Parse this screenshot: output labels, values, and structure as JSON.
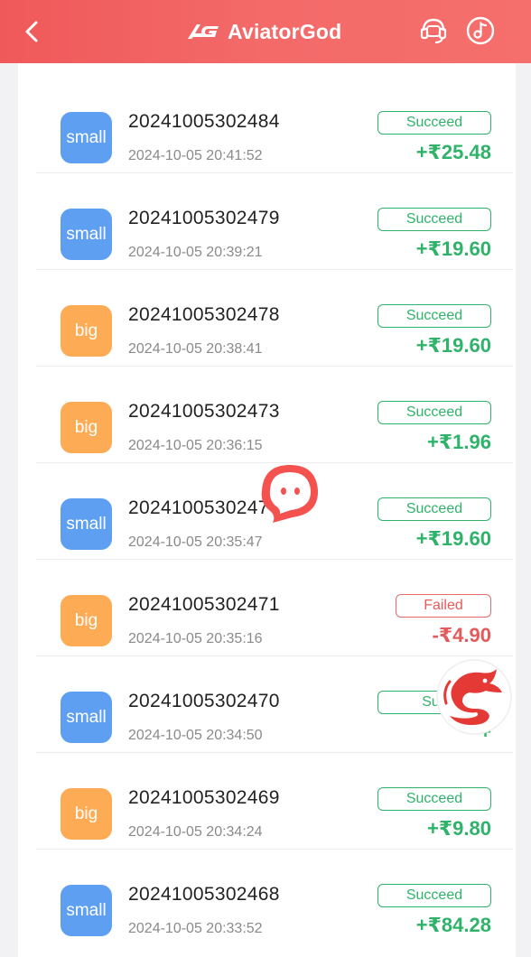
{
  "header": {
    "brand_name": "AviatorGod",
    "brand_mark": "AG",
    "icons": [
      "back-arrow-icon",
      "support-headset-icon",
      "music-note-icon"
    ],
    "colors": {
      "bar": "#f0595a",
      "text": "#ffffff"
    }
  },
  "records": [
    {
      "type": "small",
      "order": "20241005302484",
      "time": "2024-10-05 20:41:52",
      "status": "Succeed",
      "amount": "+₹25.48"
    },
    {
      "type": "small",
      "order": "20241005302479",
      "time": "2024-10-05 20:39:21",
      "status": "Succeed",
      "amount": "+₹19.60"
    },
    {
      "type": "big",
      "order": "20241005302478",
      "time": "2024-10-05 20:38:41",
      "status": "Succeed",
      "amount": "+₹19.60"
    },
    {
      "type": "big",
      "order": "20241005302473",
      "time": "2024-10-05 20:36:15",
      "status": "Succeed",
      "amount": "+₹1.96"
    },
    {
      "type": "small",
      "order": "2024100530247",
      "time": "2024-10-05 20:35:47",
      "status": "Succeed",
      "amount": "+₹19.60"
    },
    {
      "type": "big",
      "order": "20241005302471",
      "time": "2024-10-05 20:35:16",
      "status": "Failed",
      "amount": "-₹4.90"
    },
    {
      "type": "small",
      "order": "20241005302470",
      "time": "2024-10-05 20:34:50",
      "status": "Suc",
      "amount": "+"
    },
    {
      "type": "big",
      "order": "20241005302469",
      "time": "2024-10-05 20:34:24",
      "status": "Succeed",
      "amount": "+₹9.80"
    },
    {
      "type": "small",
      "order": "20241005302468",
      "time": "2024-10-05 20:33:52",
      "status": "Succeed",
      "amount": "+₹84.28"
    }
  ],
  "colors": {
    "small_badge": "#5f9ff2",
    "big_badge": "#fdab55",
    "success": "#2fb36a",
    "failed": "#e55a5a"
  },
  "floating": [
    "chat-bubble-icon",
    "dragon-icon"
  ]
}
